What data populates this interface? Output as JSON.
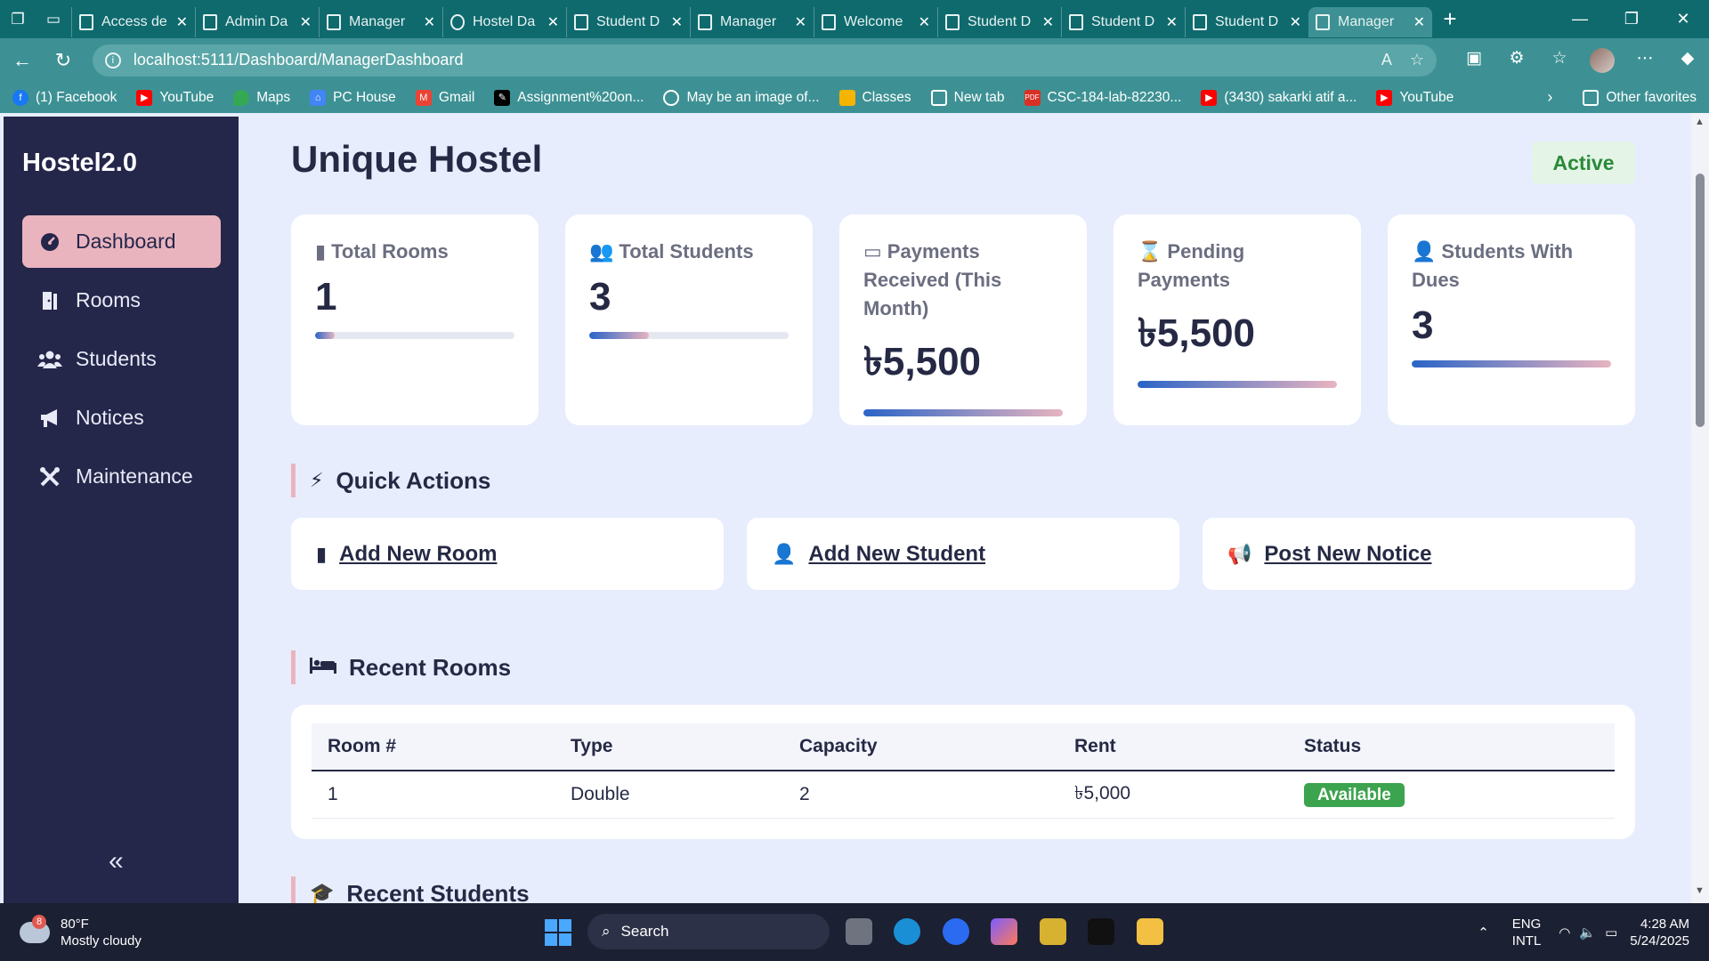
{
  "browser": {
    "tabs": [
      {
        "label": "Access de",
        "icon": "page-icon"
      },
      {
        "label": "Admin Da",
        "icon": "page-icon"
      },
      {
        "label": "Manager",
        "icon": "page-icon"
      },
      {
        "label": "Hostel Da",
        "icon": "globe-icon"
      },
      {
        "label": "Student D",
        "icon": "page-icon"
      },
      {
        "label": "Manager",
        "icon": "page-icon"
      },
      {
        "label": "Welcome",
        "icon": "page-icon"
      },
      {
        "label": "Student D",
        "icon": "page-icon"
      },
      {
        "label": "Student D",
        "icon": "page-icon"
      },
      {
        "label": "Student D",
        "icon": "page-icon"
      },
      {
        "label": "Manager",
        "icon": "page-icon",
        "active": true
      }
    ],
    "url": "localhost:5111/Dashboard/ManagerDashboard",
    "bookmarks": [
      {
        "label": "(1) Facebook",
        "color": "#1877f2",
        "icon": "facebook-icon"
      },
      {
        "label": "YouTube",
        "color": "#ff0000",
        "icon": "youtube-icon"
      },
      {
        "label": "Maps",
        "color": "#34a853",
        "icon": "maps-icon"
      },
      {
        "label": "PC House",
        "color": "#4285f4",
        "icon": "pc-house-icon"
      },
      {
        "label": "Gmail",
        "color": "#ea4335",
        "icon": "gmail-icon"
      },
      {
        "label": "Assignment%20on...",
        "color": "#000000",
        "icon": "assignment-icon"
      },
      {
        "label": "May be an image of...",
        "color": "#3d9194",
        "icon": "globe-icon"
      },
      {
        "label": "Classes",
        "color": "#f4b400",
        "icon": "classes-icon"
      },
      {
        "label": "New tab",
        "color": "#3d9194",
        "icon": "newtab-icon"
      },
      {
        "label": "CSC-184-lab-82230...",
        "color": "#d93025",
        "icon": "pdf-icon"
      },
      {
        "label": "(3430) sakarki atif a...",
        "color": "#ff0000",
        "icon": "youtube-icon"
      },
      {
        "label": "YouTube",
        "color": "#ff0000",
        "icon": "youtube-icon"
      }
    ],
    "other_favorites": "Other favorites"
  },
  "sidebar": {
    "brand": "Hostel2.0",
    "items": [
      {
        "label": "Dashboard",
        "icon": "dashboard-icon",
        "active": true
      },
      {
        "label": "Rooms",
        "icon": "door-icon"
      },
      {
        "label": "Students",
        "icon": "users-icon"
      },
      {
        "label": "Notices",
        "icon": "bullhorn-icon"
      },
      {
        "label": "Maintenance",
        "icon": "tools-icon"
      }
    ]
  },
  "header": {
    "title": "Unique Hostel",
    "status": "Active",
    "status_color": "#2a8a3a"
  },
  "stats": [
    {
      "label": "Total Rooms",
      "value": "1",
      "icon": "door-icon",
      "progress": 10
    },
    {
      "label": "Total Students",
      "value": "3",
      "icon": "users-icon",
      "progress": 30
    },
    {
      "label": "Payments Received (This Month)",
      "value": "৳5,500",
      "icon": "money-bill-icon",
      "progress": 100
    },
    {
      "label": "Pending Payments",
      "value": "৳5,500",
      "icon": "hourglass-icon",
      "progress": 100
    },
    {
      "label": "Students With Dues",
      "value": "3",
      "icon": "user-clock-icon",
      "progress": 100
    }
  ],
  "quick_actions": {
    "heading": "Quick Actions",
    "items": [
      {
        "label": "Add New Room",
        "icon": "door-icon"
      },
      {
        "label": "Add New Student",
        "icon": "user-plus-icon"
      },
      {
        "label": "Post New Notice",
        "icon": "bullhorn-icon"
      }
    ]
  },
  "recent_rooms": {
    "heading": "Recent Rooms",
    "columns": [
      "Room #",
      "Type",
      "Capacity",
      "Rent",
      "Status"
    ],
    "rows": [
      [
        "1",
        "Double",
        "2",
        "৳5,000",
        "Available"
      ]
    ]
  },
  "recent_students": {
    "heading": "Recent Students"
  },
  "taskbar": {
    "weather_temp": "80°F",
    "weather_desc": "Mostly cloudy",
    "weather_badge": "8",
    "search": "Search",
    "lang1": "ENG",
    "lang2": "INTL",
    "time": "4:28 AM",
    "date": "5/24/2025"
  },
  "colors": {
    "accent": "#eab4bf",
    "sidebar": "#24264a",
    "page_bg": "#e7edfd",
    "available": "#3ca34e"
  }
}
